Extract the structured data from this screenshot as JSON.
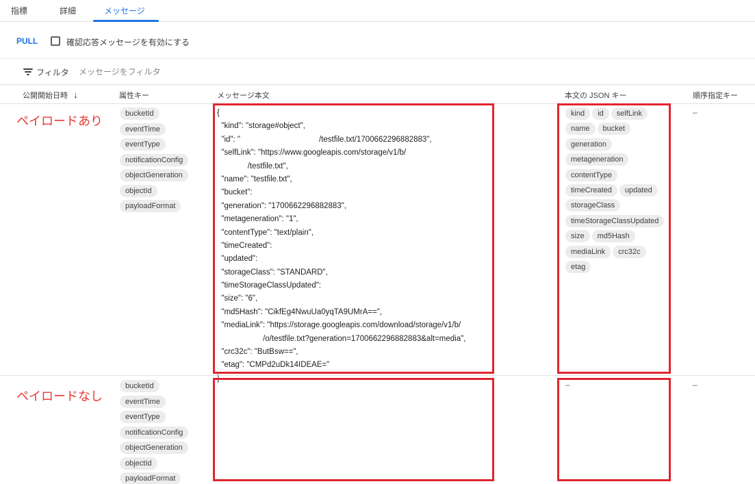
{
  "tabs": [
    {
      "label": "指標"
    },
    {
      "label": "詳細"
    },
    {
      "label": "メッセージ"
    }
  ],
  "toolbar": {
    "pull_label": "PULL",
    "ack_checkbox_label": "確認応答メッセージを有効にする",
    "ack_checkbox_checked": false
  },
  "filter": {
    "label": "フィルタ",
    "placeholder": "メッセージをフィルタ",
    "icon": "filter-list-icon"
  },
  "table": {
    "columns": {
      "publish_time": "公開開始日時",
      "sort_icon": "arrow-downward-icon",
      "attribute_keys": "属性キー",
      "message_body": "メッセージ本文",
      "json_keys": "本文の JSON キー",
      "ordering_key": "順序指定キー"
    },
    "rows": [
      {
        "annotation": "ペイロードあり",
        "attributes": [
          "bucketId",
          "eventTime",
          "eventType",
          "notificationConfig",
          "objectGeneration",
          "objectId",
          "payloadFormat"
        ],
        "body_lines": [
          "{",
          "  \"kind\": \"storage#object\",",
          "  \"id\": \"                                    /testfile.txt/1700662296882883\",",
          "  \"selfLink\": \"https://www.googleapis.com/storage/v1/b/",
          "              /testfile.txt\",",
          "  \"name\": \"testfile.txt\",",
          "  \"bucket\":",
          "  \"generation\": \"1700662296882883\",",
          "  \"metageneration\": \"1\",",
          "  \"contentType\": \"text/plain\",",
          "  \"timeCreated\":",
          "  \"updated\":",
          "  \"storageClass\": \"STANDARD\",",
          "  \"timeStorageClassUpdated\":",
          "  \"size\": \"6\",",
          "  \"md5Hash\": \"CikfEg4NwuUa0yqTA9UMrA==\",",
          "  \"mediaLink\": \"https://storage.googleapis.com/download/storage/v1/b/",
          "                     /o/testfile.txt?generation=1700662296882883&alt=media\",",
          "  \"crc32c\": \"ButBsw==\",",
          "  \"etag\": \"CMPd2uDk14IDEAE=\"",
          "}"
        ],
        "json_key_rows": [
          [
            "kind",
            "id",
            "selfLink"
          ],
          [
            "name",
            "bucket"
          ],
          [
            "generation"
          ],
          [
            "metageneration"
          ],
          [
            "contentType"
          ],
          [
            "timeCreated",
            "updated"
          ],
          [
            "storageClass"
          ],
          [
            "timeStorageClassUpdated"
          ],
          [
            "size",
            "md5Hash"
          ],
          [
            "mediaLink",
            "crc32c"
          ],
          [
            "etag"
          ]
        ],
        "ordering_key": "–"
      },
      {
        "annotation": "ペイロードなし",
        "attributes": [
          "bucketId",
          "eventTime",
          "eventType",
          "notificationConfig",
          "objectGeneration",
          "objectId",
          "payloadFormat"
        ],
        "body_lines": [],
        "json_keys_empty": "–",
        "ordering_key": "–"
      }
    ]
  },
  "colors": {
    "accent": "#1a73e8",
    "highlight_red": "#e0252f",
    "chip_bg": "#ececec"
  }
}
